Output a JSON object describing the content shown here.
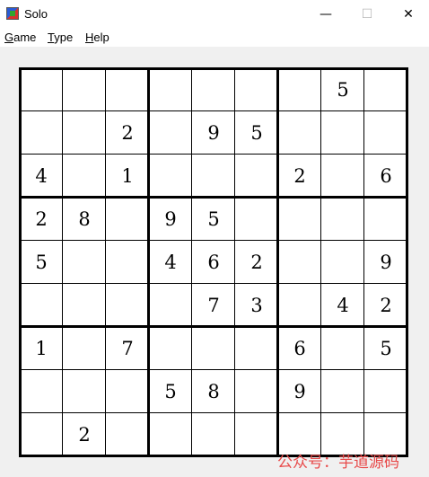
{
  "window": {
    "title": "Solo",
    "controls": {
      "minimize": "—",
      "maximize": "☐",
      "close": "✕"
    }
  },
  "menu": [
    {
      "first": "G",
      "rest": "ame"
    },
    {
      "first": "T",
      "rest": "ype"
    },
    {
      "first": "H",
      "rest": "elp"
    }
  ],
  "grid": [
    [
      "",
      "",
      "",
      "",
      "",
      "",
      "",
      "5",
      ""
    ],
    [
      "",
      "",
      "2",
      "",
      "9",
      "5",
      "",
      "",
      ""
    ],
    [
      "4",
      "",
      "1",
      "",
      "",
      "",
      "2",
      "",
      "6"
    ],
    [
      "2",
      "8",
      "",
      "9",
      "5",
      "",
      "",
      "",
      ""
    ],
    [
      "5",
      "",
      "",
      "4",
      "6",
      "2",
      "",
      "",
      "9"
    ],
    [
      "",
      "",
      "",
      "",
      "7",
      "3",
      "",
      "4",
      "2"
    ],
    [
      "1",
      "",
      "7",
      "",
      "",
      "",
      "6",
      "",
      "5"
    ],
    [
      "",
      "",
      "",
      "5",
      "8",
      "",
      "9",
      "",
      ""
    ],
    [
      "",
      "2",
      "",
      "",
      "",
      "",
      "",
      "",
      ""
    ]
  ],
  "watermark": "公众号：芋道源码"
}
